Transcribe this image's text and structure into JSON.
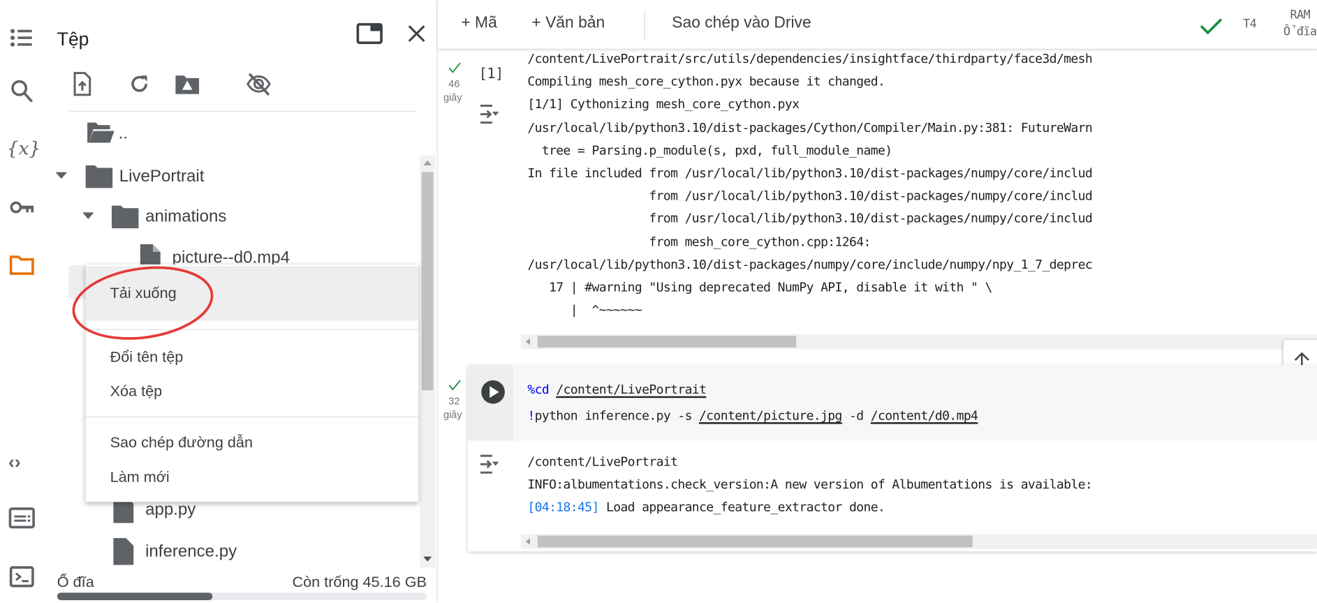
{
  "panel": {
    "title": "Tệp",
    "tree": [
      {
        "label": "..",
        "type": "folder-open"
      },
      {
        "label": "LivePortrait",
        "type": "folder",
        "expanded": true
      },
      {
        "label": "animations",
        "type": "folder",
        "expanded": true
      },
      {
        "label": "picture--d0.mp4",
        "type": "file"
      },
      {
        "label": "app.py",
        "type": "file"
      },
      {
        "label": "inference.py",
        "type": "file"
      }
    ],
    "context_menu": [
      "Tải xuống",
      "Đổi tên tệp",
      "Xóa tệp",
      "Sao chép đường dẫn",
      "Làm mới"
    ],
    "disk_label": "Ổ đĩa",
    "disk_free": "Còn trống 45.16 GB",
    "disk_used_fraction": 0.42
  },
  "toolbar": {
    "add_code": "+ Mã",
    "add_text": "+ Văn bản",
    "copy_drive": "Sao chép vào Drive",
    "runtime": "T4",
    "ram": "RAM",
    "disk": "Ổ đĩa"
  },
  "cell1": {
    "exec_count": "[1]",
    "time": "46",
    "time_unit": "giây",
    "output": [
      "/content/LivePortrait/src/utils/dependencies/insightface/thirdparty/face3d/mesh",
      "Compiling mesh_core_cython.pyx because it changed.",
      "[1/1] Cythonizing mesh_core_cython.pyx",
      "/usr/local/lib/python3.10/dist-packages/Cython/Compiler/Main.py:381: FutureWarn",
      "  tree = Parsing.p_module(s, pxd, full_module_name)",
      "In file included from /usr/local/lib/python3.10/dist-packages/numpy/core/includ",
      "                 from /usr/local/lib/python3.10/dist-packages/numpy/core/includ",
      "                 from /usr/local/lib/python3.10/dist-packages/numpy/core/includ",
      "                 from mesh_core_cython.cpp:1264:",
      "/usr/local/lib/python3.10/dist-packages/numpy/core/include/numpy/npy_1_7_deprec",
      "   17 | #warning \"Using deprecated NumPy API, disable it with \" \\",
      "      |  ^~~~~~~"
    ]
  },
  "cell2": {
    "time": "32",
    "time_unit": "giây",
    "code": {
      "l1_magic": "%cd",
      "l1_path": "/content/LivePortrait",
      "l2_bang": "!",
      "l2_a": "python inference.py -s ",
      "l2_src": "/content/picture.jpg",
      "l2_b": " -d ",
      "l2_drv": "/content/d0.mp4"
    },
    "output": [
      "/content/LivePortrait",
      "INFO:albumentations.check_version:A new version of Albumentations is available:"
    ],
    "log_time": "[04:18:45]",
    "log_msg": " Load appearance_feature_extractor done."
  },
  "colors": {
    "accent_orange": "#e8710a",
    "ok_green": "#1e8e3e",
    "annotation_red": "#e53935",
    "magic_blue": "#0000ff",
    "log_blue": "#1a73e8"
  }
}
